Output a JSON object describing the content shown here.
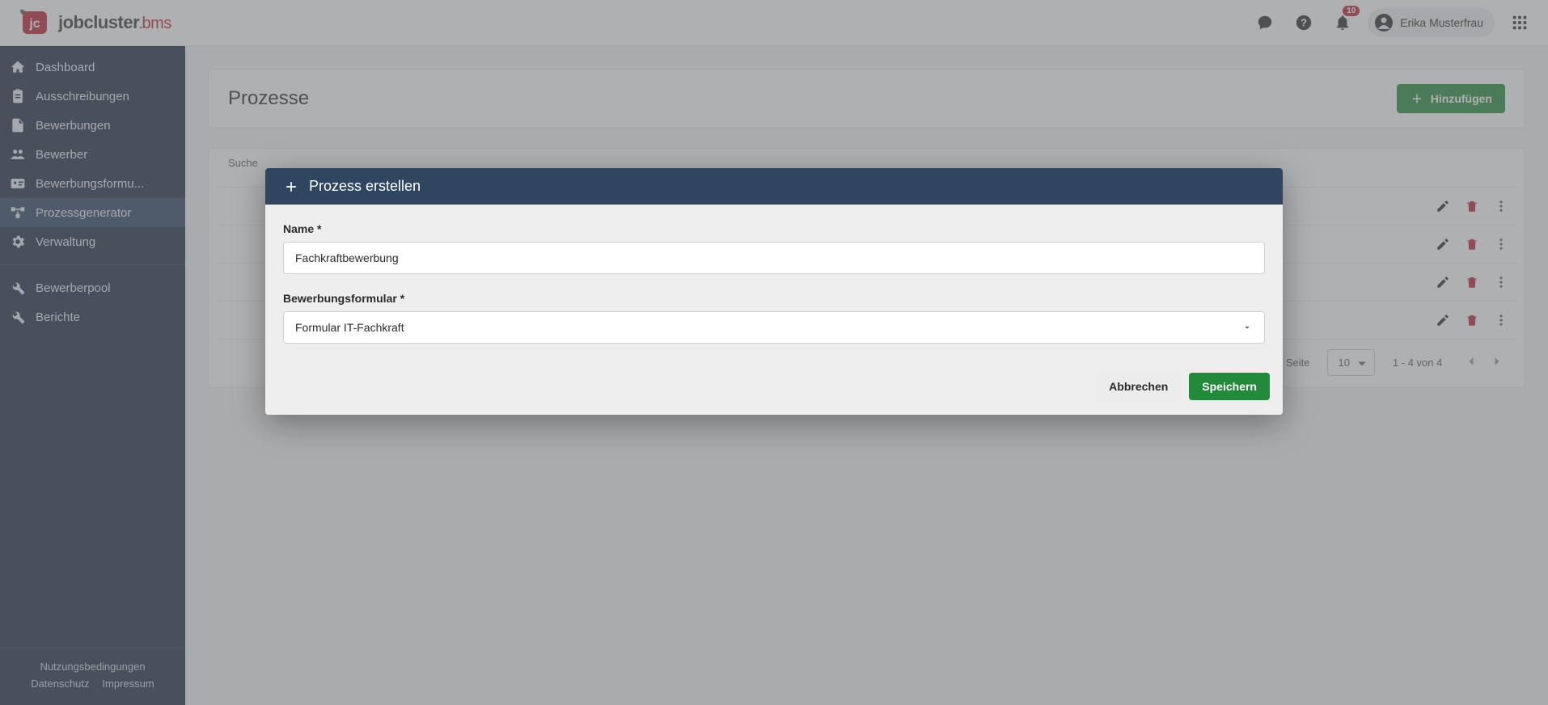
{
  "app": {
    "logo_job": "job",
    "logo_cluster": "cluster",
    "logo_dot": ".",
    "logo_bms": "bms"
  },
  "header": {
    "notification_count": "10",
    "user_name": "Erika Musterfrau"
  },
  "sidebar": {
    "items": [
      {
        "label": "Dashboard"
      },
      {
        "label": "Ausschreibungen"
      },
      {
        "label": "Bewerbungen"
      },
      {
        "label": "Bewerber"
      },
      {
        "label": "Bewerbungsformu..."
      },
      {
        "label": "Prozessgenerator"
      },
      {
        "label": "Verwaltung"
      }
    ],
    "items2": [
      {
        "label": "Bewerberpool"
      },
      {
        "label": "Berichte"
      }
    ],
    "footer": {
      "terms": "Nutzungsbedingungen",
      "privacy": "Datenschutz",
      "imprint": "Impressum"
    }
  },
  "page": {
    "title": "Prozesse",
    "add_button": "Hinzufügen",
    "search_label": "Suche",
    "entries_per_page_label": "Einträge pro Seite",
    "page_size": "10",
    "pagination_info": "1 - 4 von 4"
  },
  "modal": {
    "title": "Prozess erstellen",
    "name_label": "Name *",
    "name_value": "Fachkraftbewerbung",
    "form_label": "Bewerbungsformular *",
    "form_value": "Formular IT-Fachkraft",
    "cancel": "Abbrechen",
    "save": "Speichern"
  }
}
